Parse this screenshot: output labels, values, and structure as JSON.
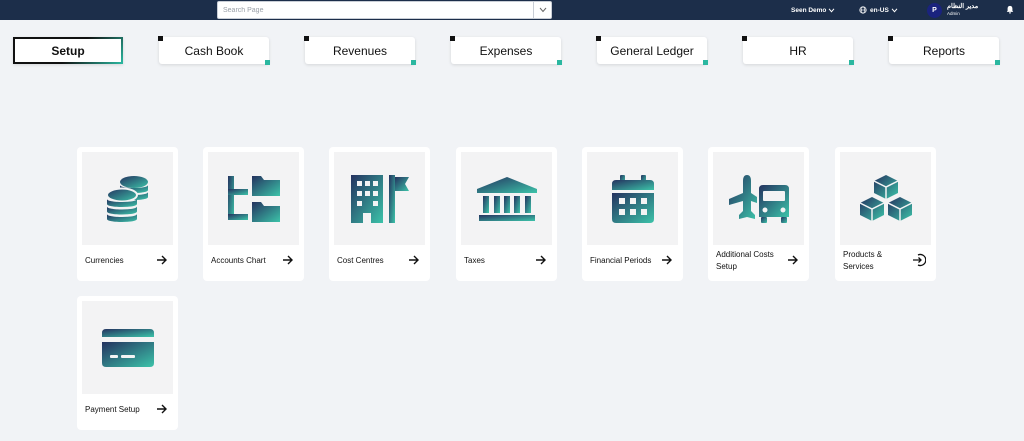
{
  "header": {
    "search_placeholder": "Search Page",
    "org_label": "Seen Demo",
    "language_label": "en-US",
    "user_initial": "P",
    "user_name": "مدير النظام",
    "user_role": "Admin"
  },
  "tabs": [
    {
      "label": "Setup",
      "active": true
    },
    {
      "label": "Cash Book",
      "active": false
    },
    {
      "label": "Revenues",
      "active": false
    },
    {
      "label": "Expenses",
      "active": false
    },
    {
      "label": "General Ledger",
      "active": false
    },
    {
      "label": "HR",
      "active": false
    },
    {
      "label": "Reports",
      "active": false
    }
  ],
  "cards": [
    {
      "label": "Currencies",
      "icon": "coins-icon",
      "action_icon": "arrow-right-icon"
    },
    {
      "label": "Accounts Chart",
      "icon": "folder-tree-icon",
      "action_icon": "arrow-right-icon"
    },
    {
      "label": "Cost Centres",
      "icon": "building-flag-icon",
      "action_icon": "arrow-right-icon"
    },
    {
      "label": "Taxes",
      "icon": "bank-icon",
      "action_icon": "arrow-right-icon"
    },
    {
      "label": "Financial Periods",
      "icon": "calendar-icon",
      "action_icon": "arrow-right-icon"
    },
    {
      "label": "Additional Costs Setup",
      "icon": "plane-truck-icon",
      "action_icon": "arrow-right-icon"
    },
    {
      "label": "Products & Services",
      "icon": "cubes-icon",
      "action_icon": "sign-in-icon"
    },
    {
      "label": "Payment Setup",
      "icon": "credit-card-icon",
      "action_icon": "arrow-right-icon"
    }
  ],
  "colors": {
    "topbar": "#1c2e4a",
    "gradient_start": "#24325f",
    "gradient_end": "#3cc3a9",
    "background": "#f1f3f6"
  }
}
